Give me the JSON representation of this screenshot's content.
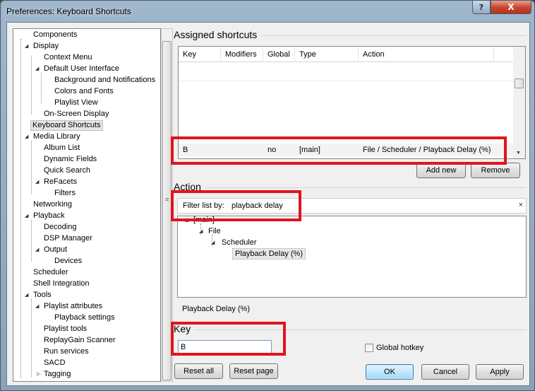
{
  "window": {
    "title": "Preferences: Keyboard Shortcuts",
    "help_label": "?",
    "close_label": "X"
  },
  "tree": {
    "items": [
      {
        "label": "Components"
      },
      {
        "label": "Display"
      },
      {
        "label": "Context Menu"
      },
      {
        "label": "Default User Interface"
      },
      {
        "label": "Background and Notifications"
      },
      {
        "label": "Colors and Fonts"
      },
      {
        "label": "Playlist View"
      },
      {
        "label": "On-Screen Display"
      },
      {
        "label": "Keyboard Shortcuts"
      },
      {
        "label": "Media Library"
      },
      {
        "label": "Album List"
      },
      {
        "label": "Dynamic Fields"
      },
      {
        "label": "Quick Search"
      },
      {
        "label": "ReFacets"
      },
      {
        "label": "Filters"
      },
      {
        "label": "Networking"
      },
      {
        "label": "Playback"
      },
      {
        "label": "Decoding"
      },
      {
        "label": "DSP Manager"
      },
      {
        "label": "Output"
      },
      {
        "label": "Devices"
      },
      {
        "label": "Scheduler"
      },
      {
        "label": "Shell Integration"
      },
      {
        "label": "Tools"
      },
      {
        "label": "Playlist attributes"
      },
      {
        "label": "Playback settings"
      },
      {
        "label": "Playlist tools"
      },
      {
        "label": "ReplayGain Scanner"
      },
      {
        "label": "Run services"
      },
      {
        "label": "SACD"
      },
      {
        "label": "Tagging"
      }
    ]
  },
  "assigned": {
    "heading": "Assigned shortcuts",
    "columns": [
      "Key",
      "Modifiers",
      "Global",
      "Type",
      "Action"
    ],
    "selected_row": {
      "key": "B",
      "modifiers": "",
      "global": "no",
      "type": "[main]",
      "action": "File / Scheduler / Playback Delay (%)"
    },
    "add_label": "Add new",
    "remove_label": "Remove"
  },
  "action": {
    "heading": "Action",
    "filter_label": "Filter list by:",
    "filter_value": "playback delay",
    "clear_label": "×",
    "tree": [
      "[main]",
      "File",
      "Scheduler",
      "Playback Delay (%)"
    ],
    "description": "Playback Delay (%)"
  },
  "key": {
    "heading": "Key",
    "value": "B",
    "global_hotkey_label": "Global hotkey",
    "global_hotkey_checked": false
  },
  "footer": {
    "reset_all": "Reset all",
    "reset_page": "Reset page",
    "ok": "OK",
    "cancel": "Cancel",
    "apply": "Apply"
  },
  "colors": {
    "highlight": "#e1141e",
    "title_bar": "#9fb6cc",
    "close_button": "#c8422c"
  }
}
